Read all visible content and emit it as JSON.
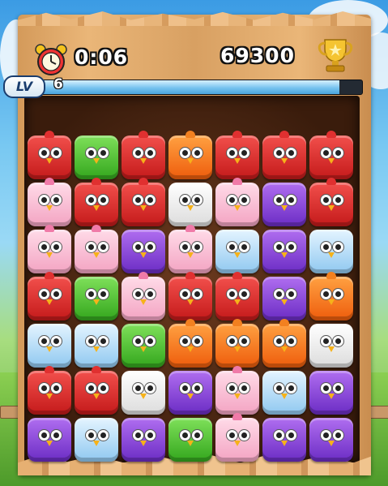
{
  "hud": {
    "timer": "0:06",
    "score": "69300",
    "level_label": "LV",
    "level_number": "6",
    "level_progress_percent": 93
  },
  "board": {
    "columns": 7,
    "rows": 7,
    "tiles": [
      [
        "red",
        "green",
        "red",
        "orange",
        "red",
        "red",
        "red"
      ],
      [
        "pink",
        "red",
        "red",
        "white",
        "pink",
        "purple",
        "red"
      ],
      [
        "pink",
        "pink",
        "purple",
        "pink",
        "blue",
        "purple",
        "blue"
      ],
      [
        "red",
        "green",
        "pink",
        "red",
        "red",
        "purple",
        "orange"
      ],
      [
        "blue",
        "blue",
        "green",
        "orange",
        "orange",
        "orange",
        "white"
      ],
      [
        "red",
        "red",
        "white",
        "purple",
        "pink",
        "blue",
        "purple"
      ],
      [
        "purple",
        "blue",
        "purple",
        "green",
        "pink",
        "purple",
        "purple"
      ]
    ]
  },
  "colors": {
    "red": "#d8282a",
    "green": "#4cbf2e",
    "orange": "#f37518",
    "white": "#f2f2f2",
    "pink": "#f7b8d0",
    "purple": "#8a45dc",
    "blue": "#b8defa",
    "progress": "#76c3ef"
  },
  "icons": {
    "timer_icon": "alarm-clock-icon",
    "score_icon": "trophy-icon"
  }
}
